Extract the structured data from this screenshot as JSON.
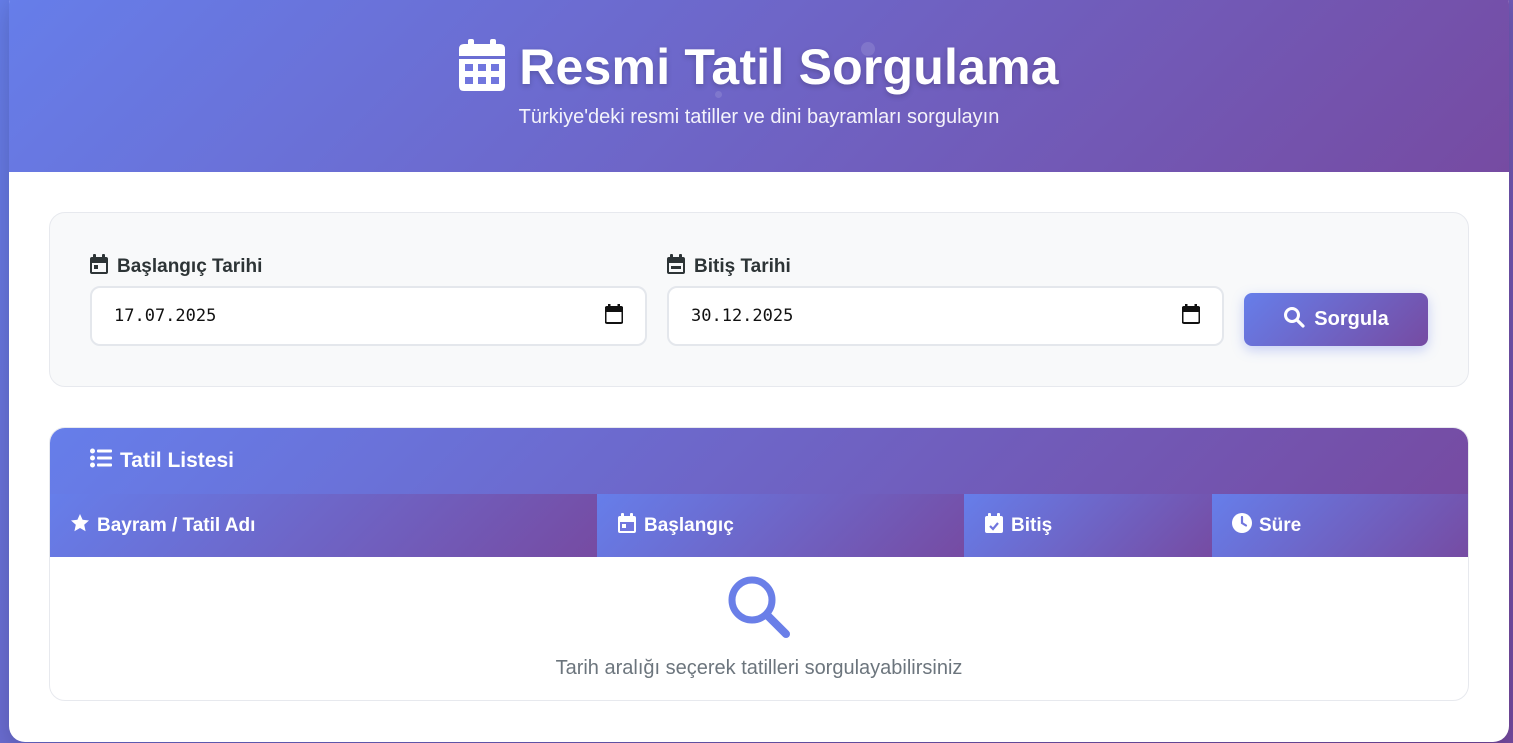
{
  "colors": {
    "gradient_start": "#667eea",
    "gradient_end": "#764ba2",
    "panel_background": "#f8f9fa",
    "label_text": "#2d3436",
    "muted_text": "#6c757d"
  },
  "header": {
    "icon": "calendar-icon",
    "title": "Resmi Tatil Sorgulama",
    "subtitle": "Türkiye'deki resmi tatiller ve dini bayramları sorgulayın"
  },
  "form": {
    "start": {
      "icon": "calendar-icon",
      "label": "Başlangıç Tarihi",
      "value": "17.07.2025"
    },
    "end": {
      "icon": "calendar-minus-icon",
      "label": "Bitiş Tarihi",
      "value": "30.12.2025"
    },
    "search_button": {
      "icon": "search-icon",
      "label": "Sorgula"
    }
  },
  "list": {
    "icon": "list-icon",
    "title": "Tatil Listesi",
    "columns": [
      {
        "icon": "star-icon",
        "label": "Bayram / Tatil Adı"
      },
      {
        "icon": "calendar-icon",
        "label": "Başlangıç"
      },
      {
        "icon": "calendar-check-icon",
        "label": "Bitiş"
      },
      {
        "icon": "clock-icon",
        "label": "Süre"
      }
    ],
    "empty_state": {
      "icon": "search-icon",
      "message": "Tarih aralığı seçerek tatilleri sorgulayabilirsiniz"
    }
  }
}
